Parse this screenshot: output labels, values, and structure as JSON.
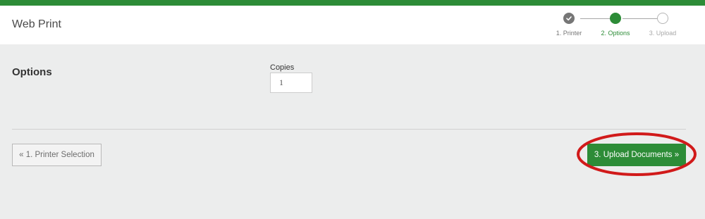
{
  "header": {
    "title": "Web Print"
  },
  "steps": [
    {
      "label": "1. Printer",
      "state": "done"
    },
    {
      "label": "2. Options",
      "state": "active"
    },
    {
      "label": "3. Upload",
      "state": "todo"
    }
  ],
  "options": {
    "section_title": "Options",
    "copies_label": "Copies",
    "copies_value": "1"
  },
  "actions": {
    "back_label": "« 1. Printer Selection",
    "next_label": "3. Upload Documents »"
  },
  "colors": {
    "brand_green": "#2d8c37",
    "annotation_red": "#d11a1a",
    "background": "#eceded"
  }
}
